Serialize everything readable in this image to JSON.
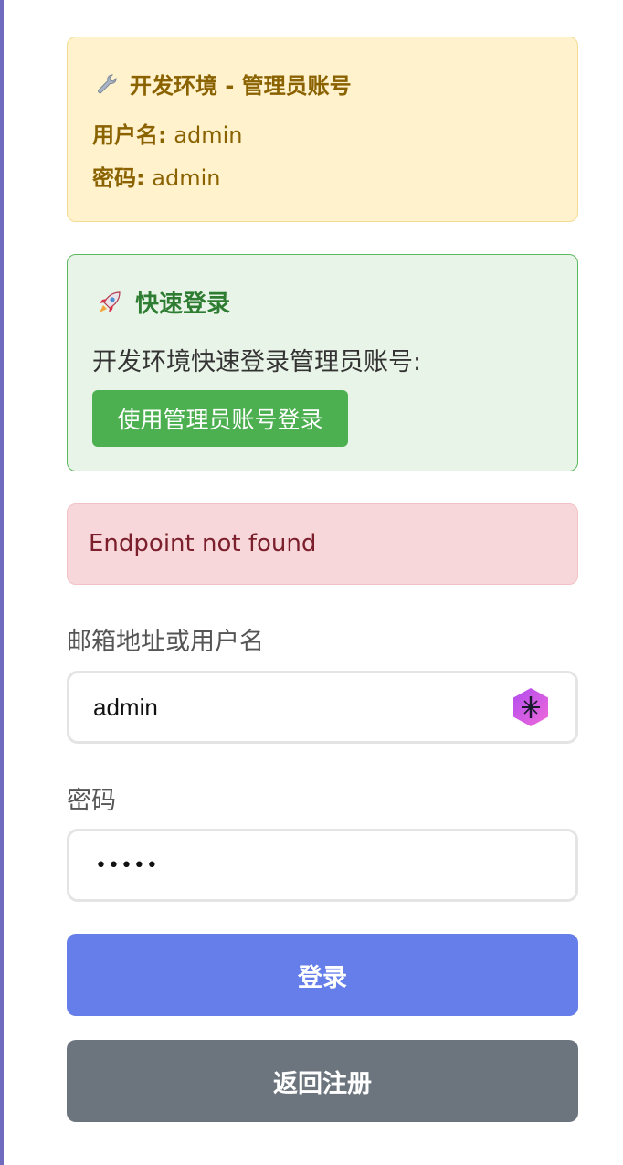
{
  "dev_account": {
    "title": "开发环境 - 管理员账号",
    "username_label": "用户名:",
    "username_value": "admin",
    "password_label": "密码:",
    "password_value": "admin"
  },
  "quick_login": {
    "title": "快速登录",
    "description": "开发环境快速登录管理员账号:",
    "button_label": "使用管理员账号登录"
  },
  "error": {
    "message": "Endpoint not found"
  },
  "form": {
    "username_label": "邮箱地址或用户名",
    "username_value": "admin",
    "password_label": "密码",
    "password_masked": "•••••"
  },
  "buttons": {
    "login": "登录",
    "back_to_register": "返回注册"
  },
  "colors": {
    "login_button": "#667eea",
    "back_button": "#6c757d",
    "quick_login_button": "#4caf50",
    "error_background": "#f8d7da",
    "dev_background": "#fff2cc"
  },
  "icons": {
    "dev_title": "wrench-icon",
    "quick_title": "rocket-icon",
    "username_field": "extension-icon"
  }
}
